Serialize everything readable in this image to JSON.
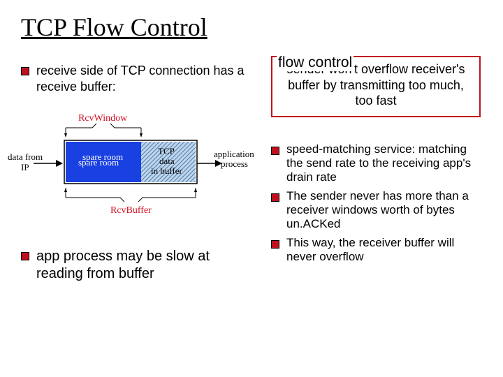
{
  "title": "TCP Flow Control",
  "left": {
    "item1": "receive side of TCP connection has a receive buffer:",
    "item2": "app process may be slow at reading from buffer"
  },
  "right": {
    "legend_label": "flow control",
    "box_text": "sender won't overflow receiver's buffer by transmitting too much, too fast",
    "list1": "speed-matching service: matching the send rate to the receiving app's drain rate",
    "list2": "The sender never has more than a receiver windows worth of bytes un.ACKed",
    "list3": "This way, the receiver buffer will never overflow"
  },
  "diagram": {
    "data_from": "data from",
    "ip": "IP",
    "spare": "spare room",
    "tcp1": "TCP",
    "tcp2": "data",
    "tcp3": "in buffer",
    "app1": "application",
    "app2": "process",
    "rcvwin": "RcvWindow",
    "rcvbuf": "RcvBuffer"
  }
}
